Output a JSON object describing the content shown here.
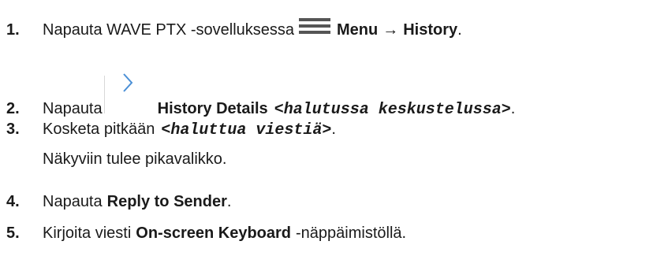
{
  "steps": [
    {
      "num": "1.",
      "text_a": "Napauta WAVE PTX -sovelluksessa",
      "icon": "hamburger-menu-icon",
      "bold_a": "Menu",
      "arrow": "→",
      "bold_b": "History",
      "end": "."
    },
    {
      "num": "2.",
      "text_a": "Napauta",
      "icon": "chevron-right-icon",
      "bold_a": "History Details",
      "mono": "<halutussa keskustelussa>",
      "end": "."
    },
    {
      "num": "3.",
      "text_a": "Kosketa pitkään",
      "mono": "<haluttua viestiä>",
      "end": ".",
      "note": "Näkyviin tulee pikavalikko."
    },
    {
      "num": "4.",
      "text_a": "Napauta",
      "bold_a": "Reply to Sender",
      "end": "."
    },
    {
      "num": "5.",
      "text_a": "Kirjoita viesti",
      "bold_a": "On-screen Keyboard",
      "text_b": "-näppäimistöllä."
    }
  ],
  "colors": {
    "text": "#1a1a1a",
    "icon": "#555555",
    "chevron": "#4a8fd6"
  }
}
